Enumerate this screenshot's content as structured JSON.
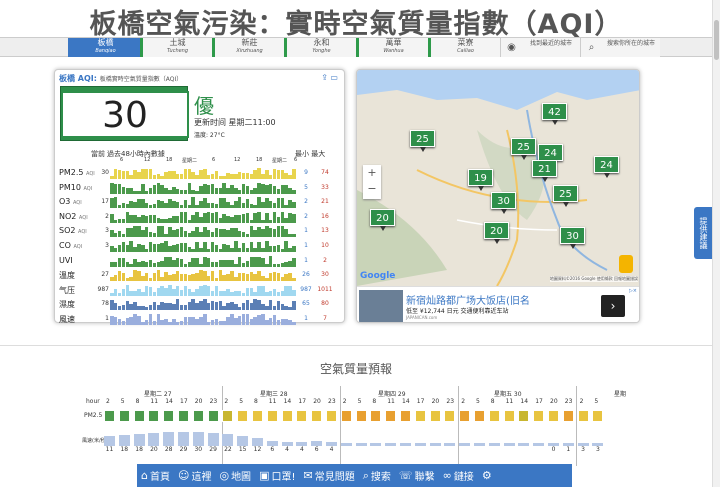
{
  "page_title": "板橋空氣污染：實時空氣質量指數（AQI）",
  "tabs": [
    {
      "zh": "板橋",
      "en": "Banqiao",
      "active": true
    },
    {
      "zh": "土城",
      "en": "Tucheng",
      "active": false
    },
    {
      "zh": "新莊",
      "en": "Xinzhuang",
      "active": false
    },
    {
      "zh": "永和",
      "en": "Yonghe",
      "active": false
    },
    {
      "zh": "萬華",
      "en": "Wanhua",
      "active": false
    },
    {
      "zh": "菜寮",
      "en": "Cailiao",
      "active": false
    }
  ],
  "find_nearest": "找到最近的城市",
  "search_city": "搜索你所在的城市",
  "aqi_card": {
    "head_title": "板橋 AQI:",
    "head_sub": "板橋實時空氣質量指數（AQI）",
    "aqi_value": "30",
    "quality": "優",
    "update_time": "更新时间 星期二11:00",
    "temperature": "溫度: 27°C",
    "col_current": "當前",
    "col_history": "過去48小時內數據",
    "col_minmax": "最小 最大",
    "hour_ticks": [
      "6",
      "12",
      "18",
      "星期二",
      "6",
      "12",
      "18",
      "星期二",
      "6"
    ]
  },
  "pollutants": [
    {
      "label": "PM2.5",
      "unit": "AQI",
      "cur": "30",
      "min": "9",
      "max": "74",
      "color": "#e8d44d"
    },
    {
      "label": "PM10",
      "unit": "AQI",
      "cur": "",
      "min": "5",
      "max": "33",
      "color": "#4c9a4c"
    },
    {
      "label": "O3",
      "unit": "AQI",
      "cur": "17",
      "min": "2",
      "max": "21",
      "color": "#4c9a4c"
    },
    {
      "label": "NO2",
      "unit": "AQI",
      "cur": "2",
      "min": "2",
      "max": "16",
      "color": "#4c9a4c"
    },
    {
      "label": "SO2",
      "unit": "AQI",
      "cur": "3",
      "min": "1",
      "max": "13",
      "color": "#4c9a4c"
    },
    {
      "label": "CO",
      "unit": "AQI",
      "cur": "3",
      "min": "1",
      "max": "10",
      "color": "#4c9a4c"
    },
    {
      "label": "UVI",
      "unit": "",
      "cur": "",
      "min": "1",
      "max": "2",
      "color": "#4c9a4c"
    },
    {
      "label": "溫度",
      "unit": "",
      "cur": "27",
      "min": "26",
      "max": "30",
      "color": "#e8c440"
    },
    {
      "label": "气压",
      "unit": "",
      "cur": "987",
      "min": "987",
      "max": "1011",
      "color": "#a0d8f0"
    },
    {
      "label": "濕度",
      "unit": "",
      "cur": "78",
      "min": "65",
      "max": "80",
      "color": "#5b7fb5"
    },
    {
      "label": "風速",
      "unit": "",
      "cur": "1",
      "min": "1",
      "max": "7",
      "color": "#9aaedd"
    }
  ],
  "map": {
    "markers": [
      "42",
      "25",
      "25",
      "24",
      "24",
      "19",
      "21",
      "25",
      "30",
      "20",
      "20",
      "30"
    ],
    "copyright": "地圖資料©2016 Google  使用條款  回報地圖錯誤",
    "zoom_in": "+",
    "zoom_out": "−",
    "google": "Google"
  },
  "ad": {
    "title": "新宿灿路都广场大饭店(旧名",
    "price": "低至 ¥12,744 日元 交通便利靠近车站",
    "source": "JAPANICAN.com",
    "arrow": "›",
    "adchoices": "▷×"
  },
  "side_button": "提供建議",
  "forecast": {
    "title": "空氣質量預報",
    "hour_label": "hour",
    "days": [
      "星期二 27",
      "星期三 28",
      "星期四 29",
      "星期五 30",
      "星期"
    ],
    "hours": [
      "2",
      "5",
      "8",
      "11",
      "14",
      "17",
      "20",
      "23",
      "2",
      "5",
      "8",
      "11",
      "14",
      "17",
      "20",
      "23",
      "2",
      "5",
      "8",
      "11",
      "14",
      "17",
      "20",
      "23",
      "2",
      "5",
      "8",
      "11",
      "14",
      "17",
      "20",
      "23",
      "2",
      "5"
    ],
    "pm_label": "PM2.5",
    "wind_label": "風速(米/秒)",
    "wind_values": [
      "11",
      "18",
      "18",
      "20",
      "28",
      "29",
      "30",
      "29",
      "22",
      "15",
      "12",
      "6",
      "4",
      "4",
      "6",
      "4",
      "",
      "",
      "",
      "",
      "",
      "",
      "",
      "",
      "",
      "",
      "",
      "",
      "",
      "",
      "0",
      "1",
      "3",
      "3"
    ]
  },
  "bottom_nav": [
    {
      "icon": "⌂",
      "label": "首頁"
    },
    {
      "icon": "☺",
      "label": "這裡"
    },
    {
      "icon": "◎",
      "label": "地圖"
    },
    {
      "icon": "▣",
      "label": "口罩!"
    },
    {
      "icon": "✉",
      "label": "常見問題"
    },
    {
      "icon": "⌕",
      "label": "搜索"
    },
    {
      "icon": "☏",
      "label": "聯繫"
    },
    {
      "icon": "∞",
      "label": "鏈接"
    },
    {
      "icon": "⚙",
      "label": ""
    }
  ]
}
